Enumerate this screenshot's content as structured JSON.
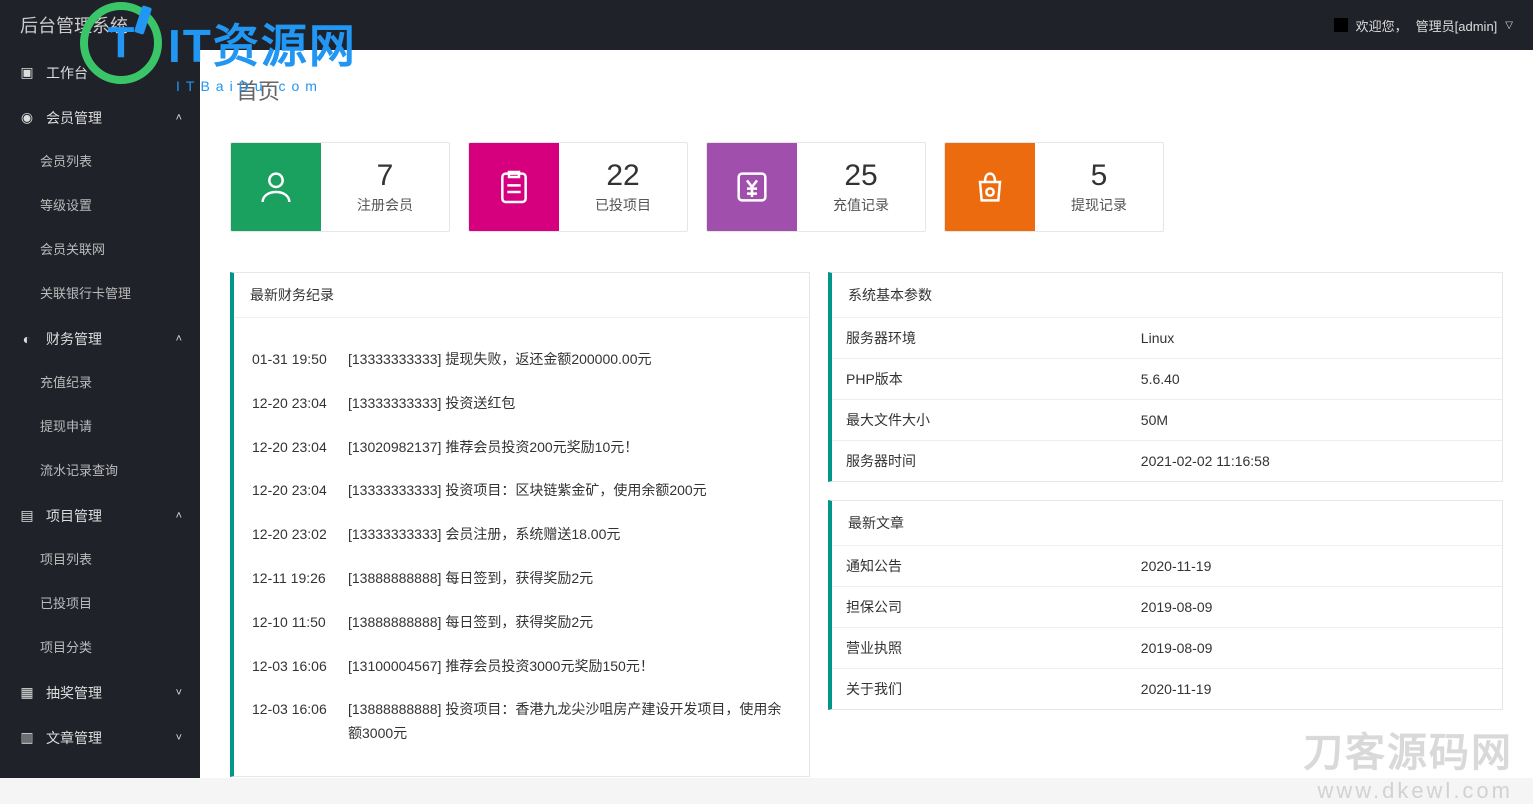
{
  "header": {
    "system_title": "后台管理系统",
    "welcome_prefix": "欢迎您，",
    "user_role": "管理员[admin]"
  },
  "watermark_top": {
    "big": "IT资源网",
    "sub": "ITBaiDu.com"
  },
  "sidebar": {
    "items": [
      {
        "icon": "grid-icon",
        "label": "工作台",
        "arrow": ""
      },
      {
        "icon": "circle-v-icon",
        "label": "会员管理",
        "arrow": "up",
        "children": [
          "会员列表",
          "等级设置",
          "会员关联网",
          "关联银行卡管理"
        ]
      },
      {
        "icon": "globe-icon",
        "label": "财务管理",
        "arrow": "up",
        "children": [
          "充值纪录",
          "提现申请",
          "流水记录查询"
        ]
      },
      {
        "icon": "doc-icon",
        "label": "项目管理",
        "arrow": "up",
        "children": [
          "项目列表",
          "已投项目",
          "项目分类"
        ]
      },
      {
        "icon": "grid4-icon",
        "label": "抽奖管理",
        "arrow": "down"
      },
      {
        "icon": "page-icon",
        "label": "文章管理",
        "arrow": "down"
      }
    ]
  },
  "breadcrumb": "首页",
  "stats": [
    {
      "color": "green",
      "icon": "user-icon",
      "value": "7",
      "label": "注册会员"
    },
    {
      "color": "pink",
      "icon": "clip-icon",
      "value": "22",
      "label": "已投项目"
    },
    {
      "color": "purple",
      "icon": "yuan-icon",
      "value": "25",
      "label": "充值记录"
    },
    {
      "color": "orange",
      "icon": "bag-icon",
      "value": "5",
      "label": "提现记录"
    }
  ],
  "finance_panel_title": "最新财务纪录",
  "finance_records": [
    {
      "time": "01-31 19:50",
      "text": "[13333333333] 提现失败，返还金额200000.00元"
    },
    {
      "time": "12-20 23:04",
      "text": "[13333333333] 投资送红包"
    },
    {
      "time": "12-20 23:04",
      "text": "[13020982137] 推荐会员投资200元奖励10元！"
    },
    {
      "time": "12-20 23:04",
      "text": "[13333333333] 投资项目：区块链紫金矿，使用余额200元"
    },
    {
      "time": "12-20 23:02",
      "text": "[13333333333] 会员注册，系统赠送18.00元"
    },
    {
      "time": "12-11 19:26",
      "text": "[13888888888] 每日签到，获得奖励2元"
    },
    {
      "time": "12-10 11:50",
      "text": "[13888888888] 每日签到，获得奖励2元"
    },
    {
      "time": "12-03 16:06",
      "text": "[13100004567] 推荐会员投资3000元奖励150元！"
    },
    {
      "time": "12-03 16:06",
      "text": "[13888888888] 投资项目：香港九龙尖沙咀房产建设开发项目，使用余额3000元"
    }
  ],
  "sysinfo_panel_title": "系统基本参数",
  "sysinfo": [
    {
      "k": "服务器环境",
      "v": "Linux"
    },
    {
      "k": "PHP版本",
      "v": "5.6.40"
    },
    {
      "k": "最大文件大小",
      "v": "50M"
    },
    {
      "k": "服务器时间",
      "v": "2021-02-02 11:16:58"
    }
  ],
  "articles_panel_title": "最新文章",
  "articles": [
    {
      "title": "通知公告",
      "date": "2020-11-19"
    },
    {
      "title": "担保公司",
      "date": "2019-08-09"
    },
    {
      "title": "营业执照",
      "date": "2019-08-09"
    },
    {
      "title": "关于我们",
      "date": "2020-11-19"
    }
  ],
  "watermark_bottom": {
    "line1": "刀客源码网",
    "line2": "www.dkewl.com"
  }
}
